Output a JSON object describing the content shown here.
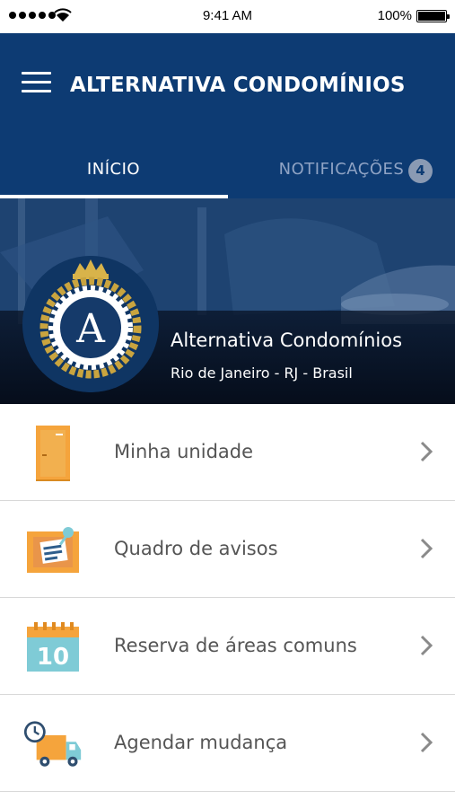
{
  "status_bar": {
    "time": "9:41 AM",
    "battery": "100%"
  },
  "header": {
    "title": "ALTERNATIVA CONDOMÍNIOS",
    "tabs": [
      {
        "label": "INÍCIO",
        "active": true
      },
      {
        "label": "NOTIFICAÇÕES",
        "badge": "4",
        "active": false
      }
    ]
  },
  "hero": {
    "name": "Alternativa Condomínios",
    "location": "Rio de Janeiro - RJ - Brasil",
    "logo_letter": "A"
  },
  "menu": {
    "items": [
      {
        "label": "Minha unidade",
        "icon": "door-icon"
      },
      {
        "label": "Quadro de avisos",
        "icon": "notice-board-icon"
      },
      {
        "label": "Reserva de áreas comuns",
        "icon": "calendar-icon"
      },
      {
        "label": "Agendar mudança",
        "icon": "moving-truck-icon"
      }
    ]
  },
  "colors": {
    "primary": "#0d3b73",
    "accent_orange": "#f5a43c",
    "accent_teal": "#7fcbd6",
    "text_gray": "#555555"
  },
  "calendar_day": "10"
}
